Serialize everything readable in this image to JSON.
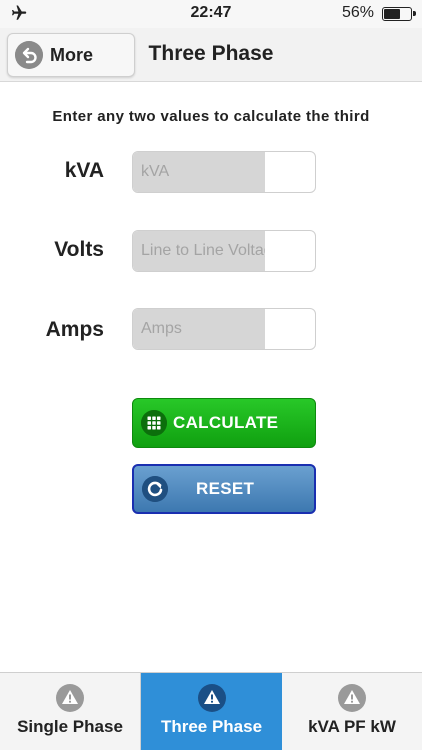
{
  "status_bar": {
    "time": "22:47",
    "battery_percent": "56%",
    "battery_level": 0.56,
    "airplane_icon": "airplane-icon",
    "battery_icon": "battery-icon"
  },
  "nav": {
    "back_label": "More",
    "back_icon": "back-arrow-icon",
    "title": "Three Phase"
  },
  "instruction": "Enter any two values to calculate the third",
  "form": {
    "kva_label": "kVA",
    "kva_placeholder": "kVA",
    "kva_value": "",
    "volts_label": "Volts",
    "volts_placeholder": "Line to Line Voltage",
    "volts_value": "",
    "amps_label": "Amps",
    "amps_placeholder": "Amps",
    "amps_value": ""
  },
  "buttons": {
    "calculate_label": "CALCULATE",
    "calculate_icon": "calculator-grid-icon",
    "reset_label": "RESET",
    "reset_icon": "refresh-icon"
  },
  "tabs": [
    {
      "label": "Single Phase",
      "icon": "warning-triangle-icon",
      "active": false
    },
    {
      "label": "Three Phase",
      "icon": "warning-triangle-icon",
      "active": true
    },
    {
      "label": "kVA PF kW",
      "icon": "warning-triangle-icon",
      "active": false
    }
  ],
  "colors": {
    "calculate_green": "#1ab41a",
    "reset_blue": "#4f8bc2",
    "active_tab_blue": "#2f8fd8"
  }
}
